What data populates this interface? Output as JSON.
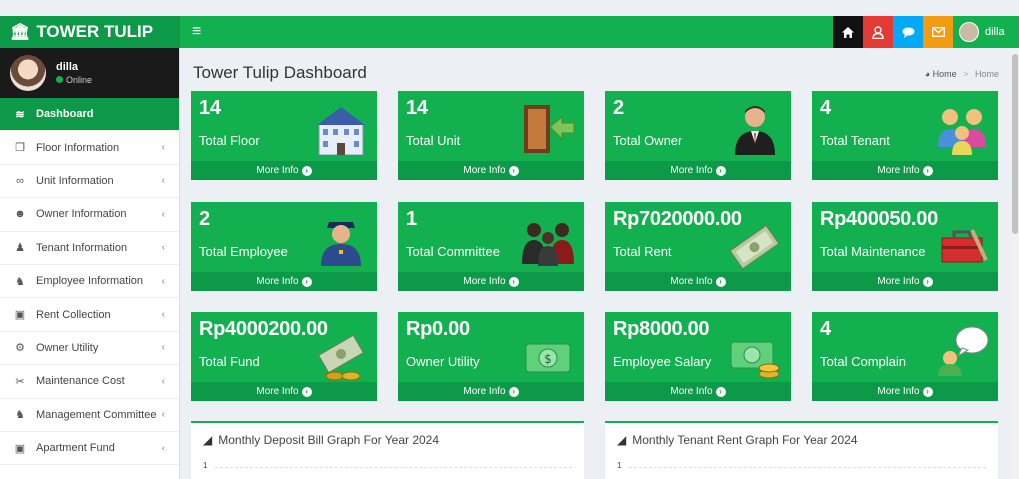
{
  "app": {
    "name": "TOWER TULIP"
  },
  "header": {
    "menu_icon": "hamburger-icon",
    "user_name": "dilla",
    "icons": [
      "home-icon",
      "user-icon",
      "chat-icon",
      "mail-icon"
    ]
  },
  "user": {
    "name": "dilla",
    "status": "Online"
  },
  "sidebar": {
    "items": [
      {
        "label": "Dashboard",
        "icon": "chart-icon"
      },
      {
        "label": "Floor Information",
        "icon": "copy-icon"
      },
      {
        "label": "Unit Information",
        "icon": "link-icon"
      },
      {
        "label": "Owner Information",
        "icon": "user-icon"
      },
      {
        "label": "Tenant Information",
        "icon": "users-icon"
      },
      {
        "label": "Employee Information",
        "icon": "person-icon"
      },
      {
        "label": "Rent Collection",
        "icon": "money-icon"
      },
      {
        "label": "Owner Utility",
        "icon": "gear-icon"
      },
      {
        "label": "Maintenance Cost",
        "icon": "scissors-icon"
      },
      {
        "label": "Management Committee",
        "icon": "person-icon"
      },
      {
        "label": "Apartment Fund",
        "icon": "money-icon"
      }
    ]
  },
  "main": {
    "title": "Tower Tulip Dashboard",
    "breadcrumb": {
      "home": "Home",
      "current": "Home"
    },
    "more_info": "More Info",
    "boxes": [
      {
        "value": "14",
        "label": "Total Floor",
        "icon": "building-icon"
      },
      {
        "value": "14",
        "label": "Total Unit",
        "icon": "door-icon"
      },
      {
        "value": "2",
        "label": "Total Owner",
        "icon": "businessman-icon"
      },
      {
        "value": "4",
        "label": "Total Tenant",
        "icon": "family-icon"
      },
      {
        "value": "2",
        "label": "Total Employee",
        "icon": "officer-icon"
      },
      {
        "value": "1",
        "label": "Total Committee",
        "icon": "meeting-icon"
      },
      {
        "value": "Rp7020000.00",
        "label": "Total Rent",
        "icon": "cash-icon"
      },
      {
        "value": "Rp400050.00",
        "label": "Total Maintenance",
        "icon": "toolbox-icon"
      },
      {
        "value": "Rp4000200.00",
        "label": "Total Fund",
        "icon": "money-coins-icon"
      },
      {
        "value": "Rp0.00",
        "label": "Owner Utility",
        "icon": "banknote-icon"
      },
      {
        "value": "Rp8000.00",
        "label": "Employee Salary",
        "icon": "salary-icon"
      },
      {
        "value": "4",
        "label": "Total Complain",
        "icon": "speech-icon"
      }
    ],
    "graphs": [
      {
        "title": "Monthly Deposit Bill Graph For Year 2024",
        "tick": "1"
      },
      {
        "title": "Monthly Tenant Rent Graph For Year 2024",
        "tick": "1"
      }
    ]
  },
  "colors": {
    "primary": "#12b04f",
    "primary_dark": "#0d9a48",
    "home": "#111111",
    "user": "#e53935",
    "chat": "#03a9f4",
    "mail": "#f39c12"
  }
}
